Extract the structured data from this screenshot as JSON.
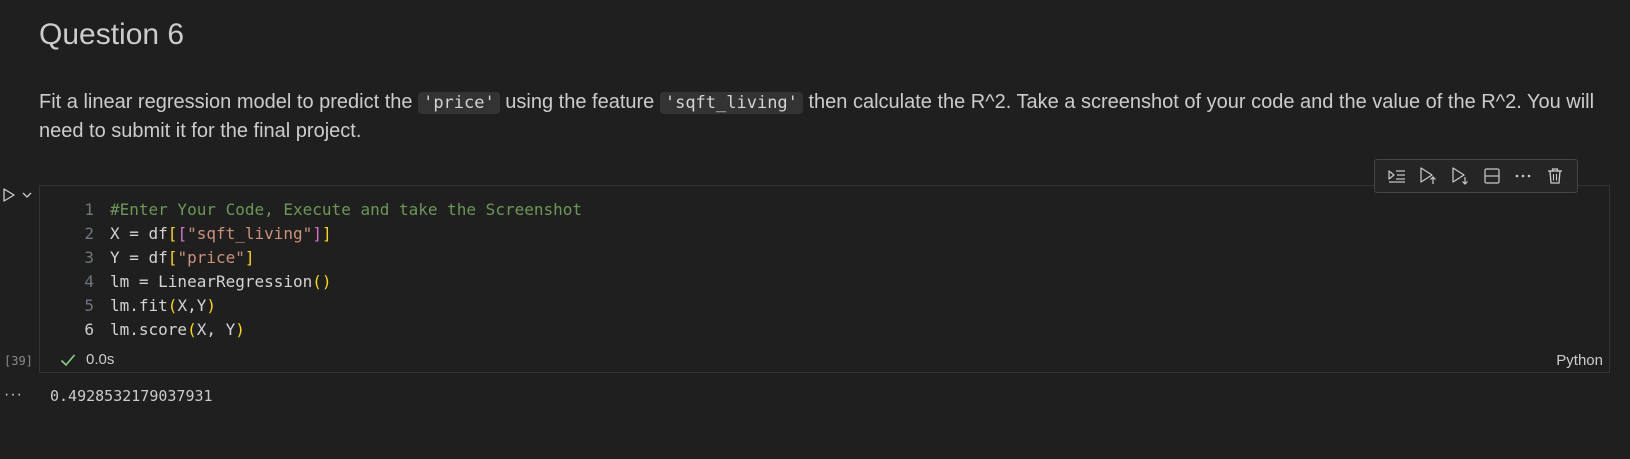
{
  "markdown": {
    "heading": "Question 6",
    "para_before_1": "Fit a linear regression model to predict the ",
    "code_1": "'price'",
    "para_between": " using the feature ",
    "code_2": "'sqft_living'",
    "para_after": " then calculate the R^2. Take a screenshot of your code and the value of the R^2. You will need to submit it for the final project."
  },
  "toolbar": {
    "icons": [
      "run-by-line-icon",
      "execute-above-icon",
      "execute-below-icon",
      "split-cell-icon",
      "more-actions-icon",
      "delete-icon"
    ]
  },
  "cell": {
    "line_numbers": [
      "1",
      "2",
      "3",
      "4",
      "5",
      "6"
    ],
    "lines": [
      "#Enter Your Code, Execute and take the Screenshot",
      "X = df[[\"sqft_living\"]]",
      "Y = df[\"price\"]",
      "lm = LinearRegression()",
      "lm.fit(X,Y)",
      "lm.score(X, Y)"
    ],
    "execution_count": "[39]",
    "exec_time": "0.0s",
    "language": "Python"
  },
  "output": {
    "more_label": "···",
    "value": "0.4928532179037931"
  },
  "colors": {
    "background": "#1f1f1f",
    "comment": "#6a9955",
    "string": "#ce9178",
    "bracket_gold": "#ffd700",
    "bracket_purple": "#da70d6",
    "success": "#89d185"
  }
}
